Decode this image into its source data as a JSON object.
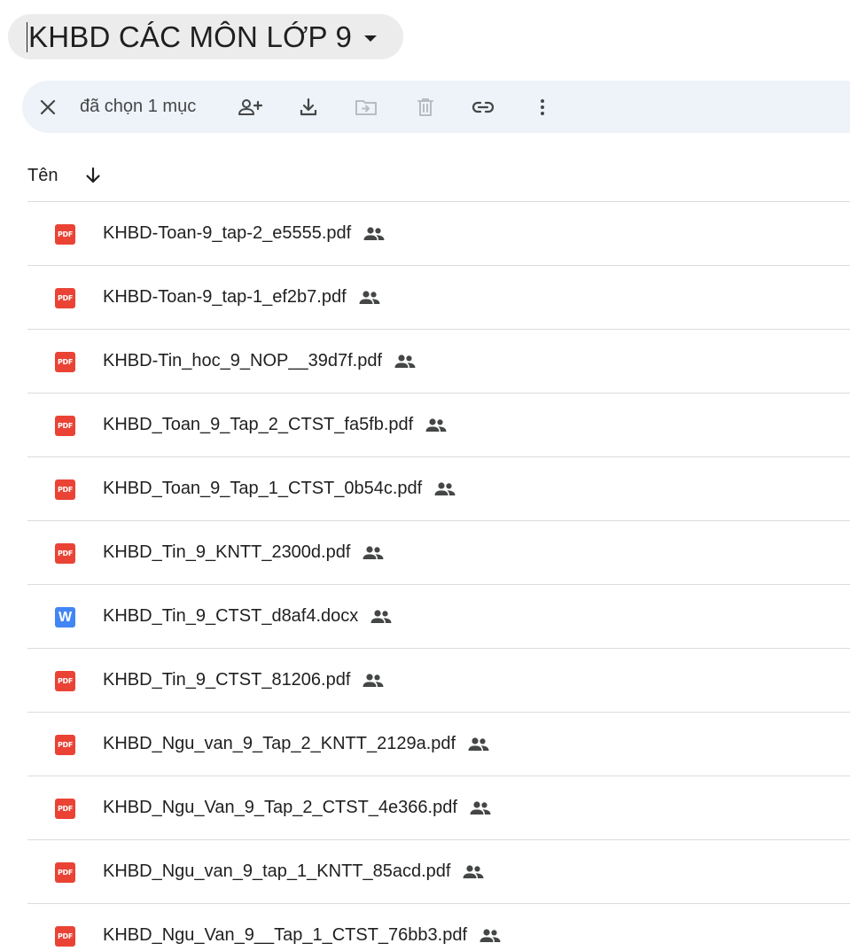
{
  "folder": {
    "title": "KHBD CÁC MÔN LỚP 9"
  },
  "toolbar": {
    "selection_label": "đã chọn 1 mục",
    "icons": [
      "close-icon",
      "share-person-add-icon",
      "download-icon",
      "move-to-folder-icon",
      "trash-icon",
      "link-icon",
      "more-vert-icon"
    ]
  },
  "list_header": {
    "name_label": "Tên",
    "sort": "descending"
  },
  "files": [
    {
      "type": "pdf",
      "type_label": "PDF",
      "name": "KHBD-Toan-9_tap-2_e5555.pdf",
      "shared": true
    },
    {
      "type": "pdf",
      "type_label": "PDF",
      "name": "KHBD-Toan-9_tap-1_ef2b7.pdf",
      "shared": true
    },
    {
      "type": "pdf",
      "type_label": "PDF",
      "name": "KHBD-Tin_hoc_9_NOP__39d7f.pdf",
      "shared": true
    },
    {
      "type": "pdf",
      "type_label": "PDF",
      "name": "KHBD_Toan_9_Tap_2_CTST_fa5fb.pdf",
      "shared": true
    },
    {
      "type": "pdf",
      "type_label": "PDF",
      "name": "KHBD_Toan_9_Tap_1_CTST_0b54c.pdf",
      "shared": true
    },
    {
      "type": "pdf",
      "type_label": "PDF",
      "name": "KHBD_Tin_9_KNTT_2300d.pdf",
      "shared": true
    },
    {
      "type": "docx",
      "type_label": "W",
      "name": "KHBD_Tin_9_CTST_d8af4.docx",
      "shared": true
    },
    {
      "type": "pdf",
      "type_label": "PDF",
      "name": "KHBD_Tin_9_CTST_81206.pdf",
      "shared": true
    },
    {
      "type": "pdf",
      "type_label": "PDF",
      "name": "KHBD_Ngu_van_9_Tap_2_KNTT_2129a.pdf",
      "shared": true
    },
    {
      "type": "pdf",
      "type_label": "PDF",
      "name": "KHBD_Ngu_Van_9_Tap_2_CTST_4e366.pdf",
      "shared": true
    },
    {
      "type": "pdf",
      "type_label": "PDF",
      "name": "KHBD_Ngu_van_9_tap_1_KNTT_85acd.pdf",
      "shared": true
    },
    {
      "type": "pdf",
      "type_label": "PDF",
      "name": "KHBD_Ngu_Van_9__Tap_1_CTST_76bb3.pdf",
      "shared": true
    }
  ],
  "colors": {
    "pdf_icon": "#ea4335",
    "docx_icon": "#4285f4",
    "toolbar_bg": "#eef2f9",
    "title_bg": "#ececec"
  }
}
